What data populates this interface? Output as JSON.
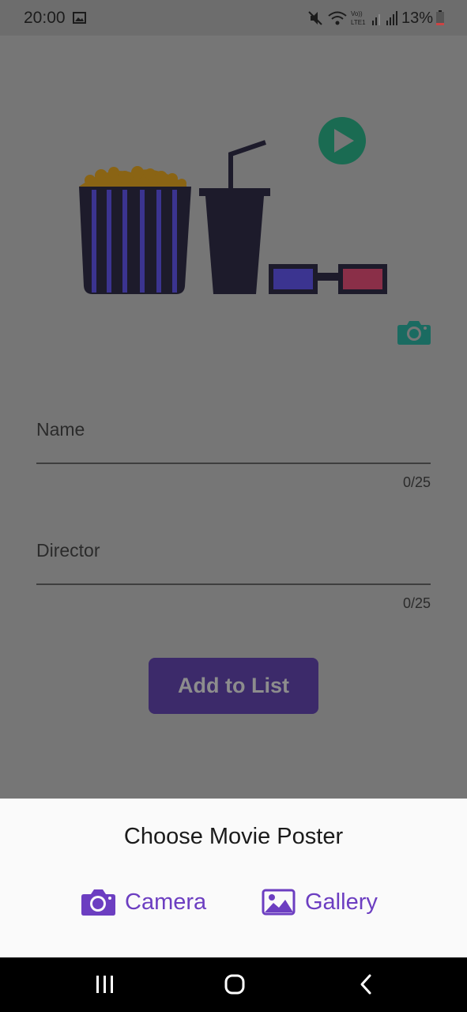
{
  "status_bar": {
    "time": "20:00",
    "battery": "13%",
    "icons": [
      "gallery-icon",
      "mute-icon",
      "wifi-icon",
      "volte-icon",
      "signal-icon",
      "battery-icon"
    ]
  },
  "form": {
    "name_label": "Name",
    "name_counter": "0/25",
    "director_label": "Director",
    "director_counter": "0/25",
    "add_button_label": "Add to List"
  },
  "sheet": {
    "title": "Choose Movie Poster",
    "camera_label": "Camera",
    "gallery_label": "Gallery"
  },
  "colors": {
    "accent": "#6c3ec1",
    "overlay_button": "#3c2a6a",
    "teal": "#1a6b61"
  },
  "nav_bar": {
    "icons": [
      "recents-icon",
      "home-icon",
      "back-icon"
    ]
  }
}
